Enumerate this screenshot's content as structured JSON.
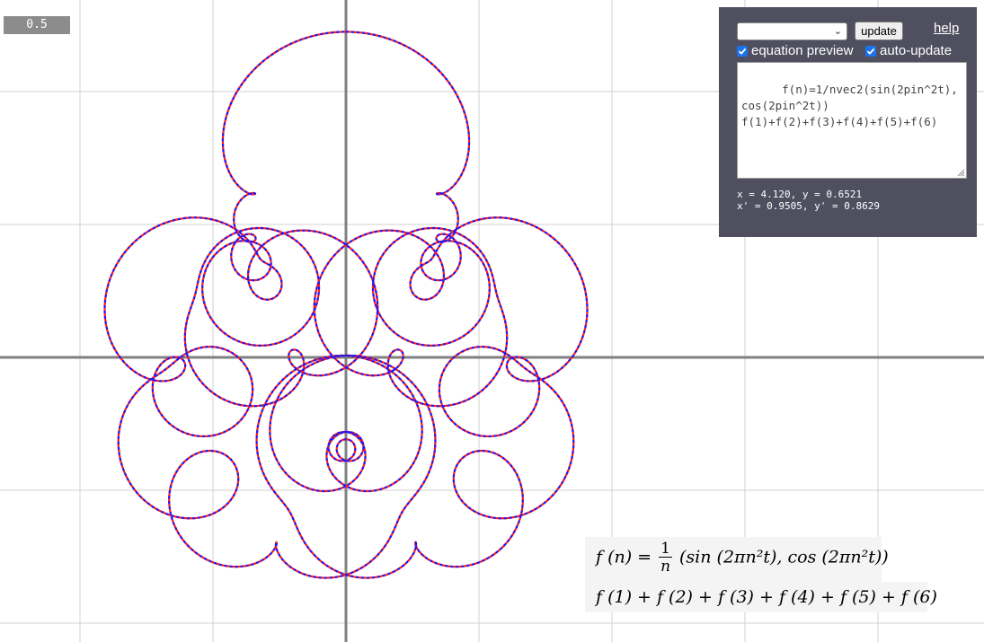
{
  "t_value": "0.5",
  "panel": {
    "selected_preset": "",
    "update_label": "update",
    "help_label": "help",
    "equation_preview_label": "equation preview",
    "equation_preview_checked": true,
    "auto_update_label": "auto-update",
    "auto_update_checked": true,
    "code": "f(n)=1/nvec2(sin(2pin^2t),cos(2pin^2t))\nf(1)+f(2)+f(3)+f(4)+f(5)+f(6)",
    "readout_line1": "x = 4.120, y = 0.6521",
    "readout_line2": "x' = 0.9505, y' = 0.8629"
  },
  "equation": {
    "lhs": "f (n) =",
    "numerator": "1",
    "denominator": "n",
    "rhs": "(sin (2πn²t), cos (2πn²t))",
    "sum": "f (1) + f (2) + f (3) + f (4) + f (5) + f (6)"
  },
  "plot": {
    "n_terms": 6,
    "curve_colors": [
      "#ff1a1a",
      "#1a1aff"
    ],
    "grid_color": "#d0d0d0",
    "axis_color": "#808080"
  }
}
